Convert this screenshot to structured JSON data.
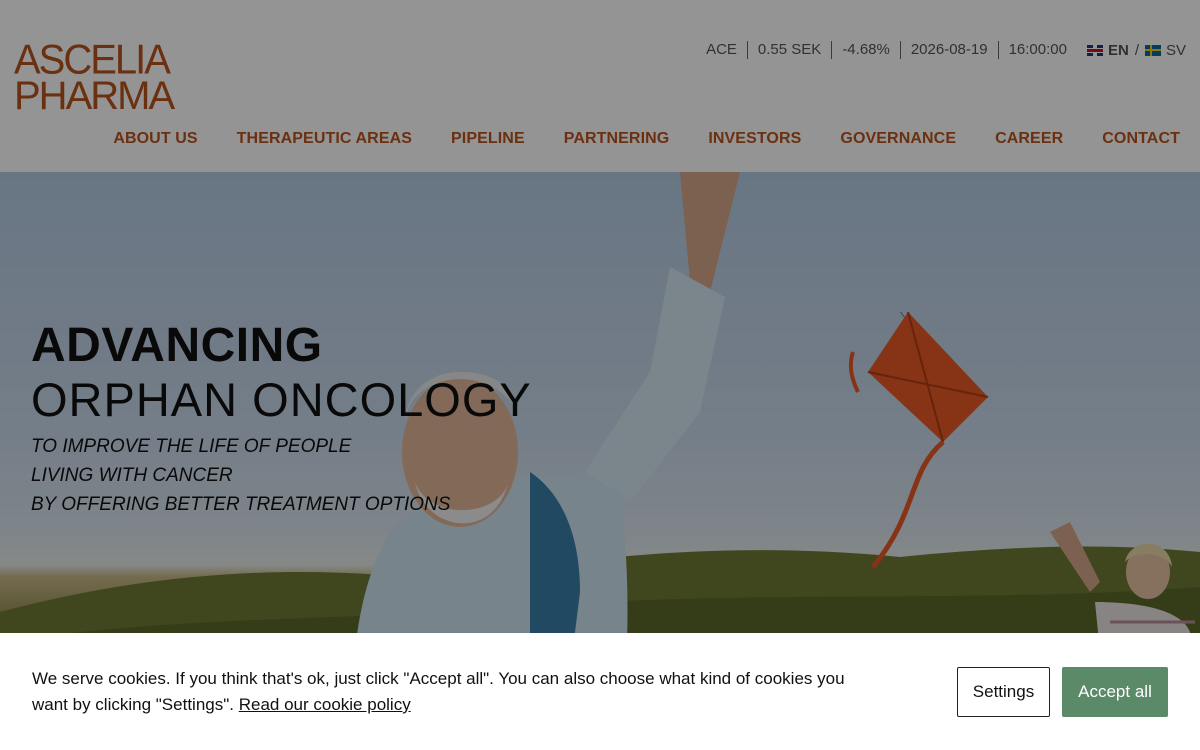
{
  "brand": {
    "line1": "ASCELIA",
    "line2": "PHARMA",
    "color": "#b8531c"
  },
  "ticker": {
    "symbol": "ACE",
    "price": "0.55 SEK",
    "change": "-4.68%",
    "date": "2026-08-19",
    "time": "16:00:00"
  },
  "language": {
    "en": "EN",
    "separator": "/",
    "sv": "SV"
  },
  "nav": {
    "items": [
      {
        "label": "ABOUT US"
      },
      {
        "label": "THERAPEUTIC AREAS"
      },
      {
        "label": "PIPELINE"
      },
      {
        "label": "PARTNERING"
      },
      {
        "label": "INVESTORS"
      },
      {
        "label": "GOVERNANCE"
      },
      {
        "label": "CAREER"
      },
      {
        "label": "CONTACT"
      }
    ]
  },
  "hero": {
    "headline_bold": "ADVANCING",
    "headline_light": "ORPHAN ONCOLOGY",
    "sub_lines": [
      "TO IMPROVE THE LIFE OF PEOPLE",
      "LIVING WITH CANCER",
      "BY OFFERING BETTER TREATMENT OPTIONS"
    ]
  },
  "cookie": {
    "text": "We serve cookies. If you think that's ok, just click \"Accept all\". You can also choose what kind of cookies you want by clicking \"Settings\". ",
    "policy_link": "Read our cookie policy",
    "settings_label": "Settings",
    "accept_label": "Accept all",
    "accept_color": "#5a8a68"
  }
}
